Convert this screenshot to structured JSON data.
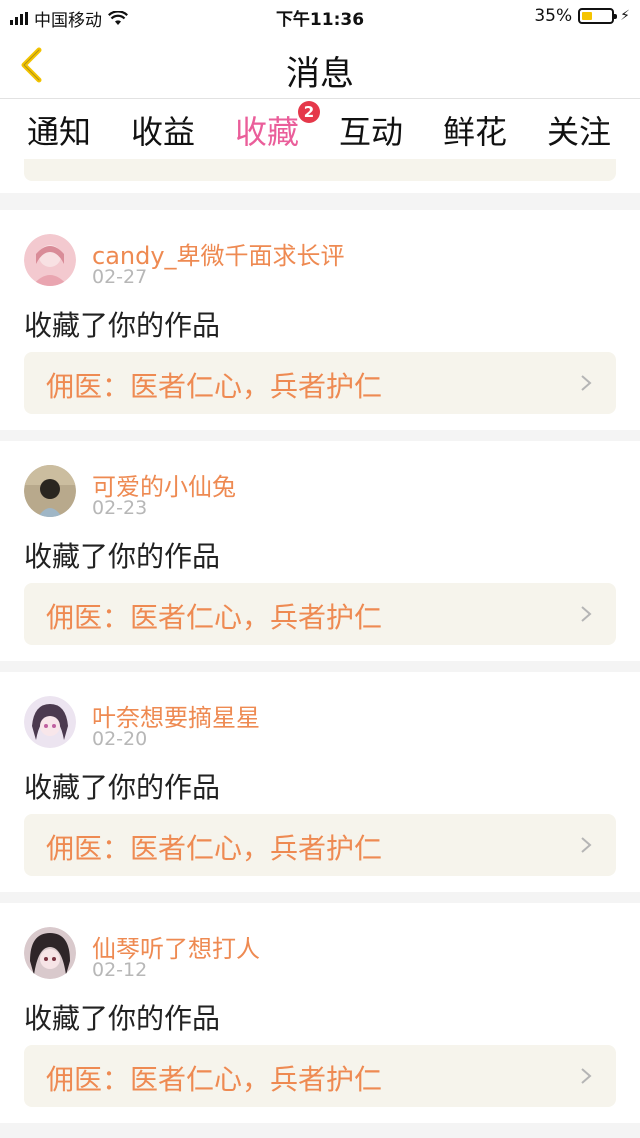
{
  "status_bar": {
    "carrier": "中国移动",
    "time": "下午11:36",
    "battery": "35%",
    "battery_level": 0.35,
    "icons": [
      "signal-icon",
      "wifi-icon",
      "battery-icon",
      "charging-bolt-icon"
    ]
  },
  "header": {
    "title": "消息",
    "back_icon": "back-chevron-icon"
  },
  "tabs": [
    {
      "label": "通知"
    },
    {
      "label": "收益"
    },
    {
      "label": "收藏",
      "active": true,
      "badge": "2"
    },
    {
      "label": "互动"
    },
    {
      "label": "鲜花"
    },
    {
      "label": "关注"
    }
  ],
  "messages": [
    {
      "user": "candy_卑微千面求长评",
      "date": "02-27",
      "action": "收藏了你的作品",
      "work": "佣医：医者仁心，兵者护仁",
      "avatar": "avatar-1"
    },
    {
      "user": "可爱的小仙兔",
      "date": "02-23",
      "action": "收藏了你的作品",
      "work": "佣医：医者仁心，兵者护仁",
      "avatar": "avatar-2"
    },
    {
      "user": "叶奈想要摘星星",
      "date": "02-20",
      "action": "收藏了你的作品",
      "work": "佣医：医者仁心，兵者护仁",
      "avatar": "avatar-3"
    },
    {
      "user": "仙琴听了想打人",
      "date": "02-12",
      "action": "收藏了你的作品",
      "work": "佣医：医者仁心，兵者护仁",
      "avatar": "avatar-4"
    }
  ],
  "colors": {
    "accent_pink": "#ea5e9a",
    "name_orange": "#ee8a52",
    "badge_red": "#e5384a",
    "back_yellow": "#f2c300"
  }
}
